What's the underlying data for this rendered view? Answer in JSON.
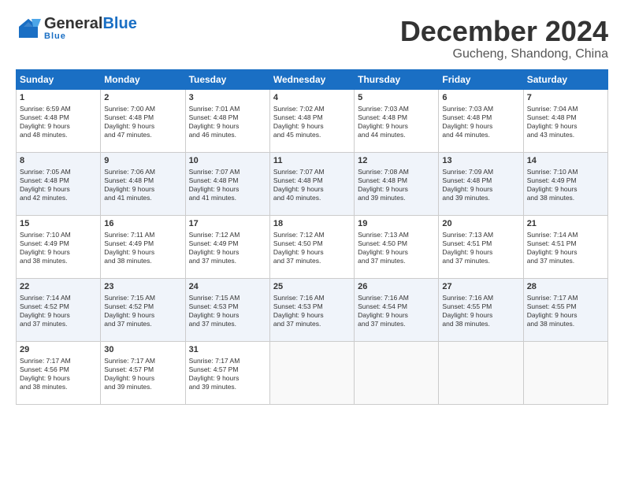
{
  "header": {
    "logo_general": "General",
    "logo_blue": "Blue",
    "title": "December 2024",
    "subtitle": "Gucheng, Shandong, China"
  },
  "weekdays": [
    "Sunday",
    "Monday",
    "Tuesday",
    "Wednesday",
    "Thursday",
    "Friday",
    "Saturday"
  ],
  "weeks": [
    [
      {
        "day": "1",
        "lines": [
          "Sunrise: 6:59 AM",
          "Sunset: 4:48 PM",
          "Daylight: 9 hours",
          "and 48 minutes."
        ]
      },
      {
        "day": "2",
        "lines": [
          "Sunrise: 7:00 AM",
          "Sunset: 4:48 PM",
          "Daylight: 9 hours",
          "and 47 minutes."
        ]
      },
      {
        "day": "3",
        "lines": [
          "Sunrise: 7:01 AM",
          "Sunset: 4:48 PM",
          "Daylight: 9 hours",
          "and 46 minutes."
        ]
      },
      {
        "day": "4",
        "lines": [
          "Sunrise: 7:02 AM",
          "Sunset: 4:48 PM",
          "Daylight: 9 hours",
          "and 45 minutes."
        ]
      },
      {
        "day": "5",
        "lines": [
          "Sunrise: 7:03 AM",
          "Sunset: 4:48 PM",
          "Daylight: 9 hours",
          "and 44 minutes."
        ]
      },
      {
        "day": "6",
        "lines": [
          "Sunrise: 7:03 AM",
          "Sunset: 4:48 PM",
          "Daylight: 9 hours",
          "and 44 minutes."
        ]
      },
      {
        "day": "7",
        "lines": [
          "Sunrise: 7:04 AM",
          "Sunset: 4:48 PM",
          "Daylight: 9 hours",
          "and 43 minutes."
        ]
      }
    ],
    [
      {
        "day": "8",
        "lines": [
          "Sunrise: 7:05 AM",
          "Sunset: 4:48 PM",
          "Daylight: 9 hours",
          "and 42 minutes."
        ]
      },
      {
        "day": "9",
        "lines": [
          "Sunrise: 7:06 AM",
          "Sunset: 4:48 PM",
          "Daylight: 9 hours",
          "and 41 minutes."
        ]
      },
      {
        "day": "10",
        "lines": [
          "Sunrise: 7:07 AM",
          "Sunset: 4:48 PM",
          "Daylight: 9 hours",
          "and 41 minutes."
        ]
      },
      {
        "day": "11",
        "lines": [
          "Sunrise: 7:07 AM",
          "Sunset: 4:48 PM",
          "Daylight: 9 hours",
          "and 40 minutes."
        ]
      },
      {
        "day": "12",
        "lines": [
          "Sunrise: 7:08 AM",
          "Sunset: 4:48 PM",
          "Daylight: 9 hours",
          "and 39 minutes."
        ]
      },
      {
        "day": "13",
        "lines": [
          "Sunrise: 7:09 AM",
          "Sunset: 4:48 PM",
          "Daylight: 9 hours",
          "and 39 minutes."
        ]
      },
      {
        "day": "14",
        "lines": [
          "Sunrise: 7:10 AM",
          "Sunset: 4:49 PM",
          "Daylight: 9 hours",
          "and 38 minutes."
        ]
      }
    ],
    [
      {
        "day": "15",
        "lines": [
          "Sunrise: 7:10 AM",
          "Sunset: 4:49 PM",
          "Daylight: 9 hours",
          "and 38 minutes."
        ]
      },
      {
        "day": "16",
        "lines": [
          "Sunrise: 7:11 AM",
          "Sunset: 4:49 PM",
          "Daylight: 9 hours",
          "and 38 minutes."
        ]
      },
      {
        "day": "17",
        "lines": [
          "Sunrise: 7:12 AM",
          "Sunset: 4:49 PM",
          "Daylight: 9 hours",
          "and 37 minutes."
        ]
      },
      {
        "day": "18",
        "lines": [
          "Sunrise: 7:12 AM",
          "Sunset: 4:50 PM",
          "Daylight: 9 hours",
          "and 37 minutes."
        ]
      },
      {
        "day": "19",
        "lines": [
          "Sunrise: 7:13 AM",
          "Sunset: 4:50 PM",
          "Daylight: 9 hours",
          "and 37 minutes."
        ]
      },
      {
        "day": "20",
        "lines": [
          "Sunrise: 7:13 AM",
          "Sunset: 4:51 PM",
          "Daylight: 9 hours",
          "and 37 minutes."
        ]
      },
      {
        "day": "21",
        "lines": [
          "Sunrise: 7:14 AM",
          "Sunset: 4:51 PM",
          "Daylight: 9 hours",
          "and 37 minutes."
        ]
      }
    ],
    [
      {
        "day": "22",
        "lines": [
          "Sunrise: 7:14 AM",
          "Sunset: 4:52 PM",
          "Daylight: 9 hours",
          "and 37 minutes."
        ]
      },
      {
        "day": "23",
        "lines": [
          "Sunrise: 7:15 AM",
          "Sunset: 4:52 PM",
          "Daylight: 9 hours",
          "and 37 minutes."
        ]
      },
      {
        "day": "24",
        "lines": [
          "Sunrise: 7:15 AM",
          "Sunset: 4:53 PM",
          "Daylight: 9 hours",
          "and 37 minutes."
        ]
      },
      {
        "day": "25",
        "lines": [
          "Sunrise: 7:16 AM",
          "Sunset: 4:53 PM",
          "Daylight: 9 hours",
          "and 37 minutes."
        ]
      },
      {
        "day": "26",
        "lines": [
          "Sunrise: 7:16 AM",
          "Sunset: 4:54 PM",
          "Daylight: 9 hours",
          "and 37 minutes."
        ]
      },
      {
        "day": "27",
        "lines": [
          "Sunrise: 7:16 AM",
          "Sunset: 4:55 PM",
          "Daylight: 9 hours",
          "and 38 minutes."
        ]
      },
      {
        "day": "28",
        "lines": [
          "Sunrise: 7:17 AM",
          "Sunset: 4:55 PM",
          "Daylight: 9 hours",
          "and 38 minutes."
        ]
      }
    ],
    [
      {
        "day": "29",
        "lines": [
          "Sunrise: 7:17 AM",
          "Sunset: 4:56 PM",
          "Daylight: 9 hours",
          "and 38 minutes."
        ]
      },
      {
        "day": "30",
        "lines": [
          "Sunrise: 7:17 AM",
          "Sunset: 4:57 PM",
          "Daylight: 9 hours",
          "and 39 minutes."
        ]
      },
      {
        "day": "31",
        "lines": [
          "Sunrise: 7:17 AM",
          "Sunset: 4:57 PM",
          "Daylight: 9 hours",
          "and 39 minutes."
        ]
      },
      null,
      null,
      null,
      null
    ]
  ]
}
